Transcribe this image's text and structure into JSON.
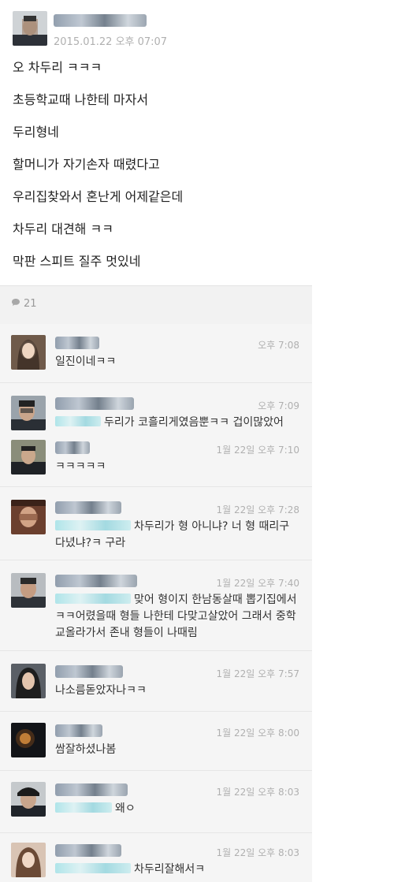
{
  "post": {
    "timestamp": "2015.01.22 오후 07:07",
    "lines": [
      "오 차두리 ㅋㅋㅋ",
      "초등학교때 나한테 마자서",
      "두리형네",
      "할머니가 자기손자 때렸다고",
      "우리집찾와서 혼난게 어제같은데",
      "차두리 대견해 ㅋㅋ",
      "막판 스피트 질주 멋있네"
    ]
  },
  "comments_bar": {
    "count": "21",
    "icon": "comment-bubble-icon"
  },
  "comments": [
    {
      "time": "오후 7:08",
      "text": "일진이네ㅋㅋ"
    },
    {
      "time": "오후 7:09",
      "text": "두리가 코흘리게였음뿐ㅋㅋ 겁이많았어"
    },
    {
      "time": "1월 22일 오후 7:10",
      "text": "ㅋㅋㅋㅋㅋ"
    },
    {
      "time": "1월 22일 오후 7:28",
      "text": "차두리가 형 아니냐? 너 형 때리구 다녔냐?ㅋ 구라"
    },
    {
      "time": "1월 22일 오후 7:40",
      "text": "맞어 형이지 한남동살때 뽑기집에서 ㅋㅋ어렸을때 형들 나한테 다맞고살았어 그래서 중학교올라가서 존내 형들이 나때림"
    },
    {
      "time": "1월 22일 오후 7:57",
      "text": "나소름돋았자나ㅋㅋ"
    },
    {
      "time": "1월 22일 오후 8:00",
      "text": "쌈잘하셨나봄"
    },
    {
      "time": "1월 22일 오후 8:03",
      "text": "왜ㅇ"
    },
    {
      "time": "1월 22일 오후 8:03",
      "text": "차두리잘해서ㅋ"
    }
  ]
}
